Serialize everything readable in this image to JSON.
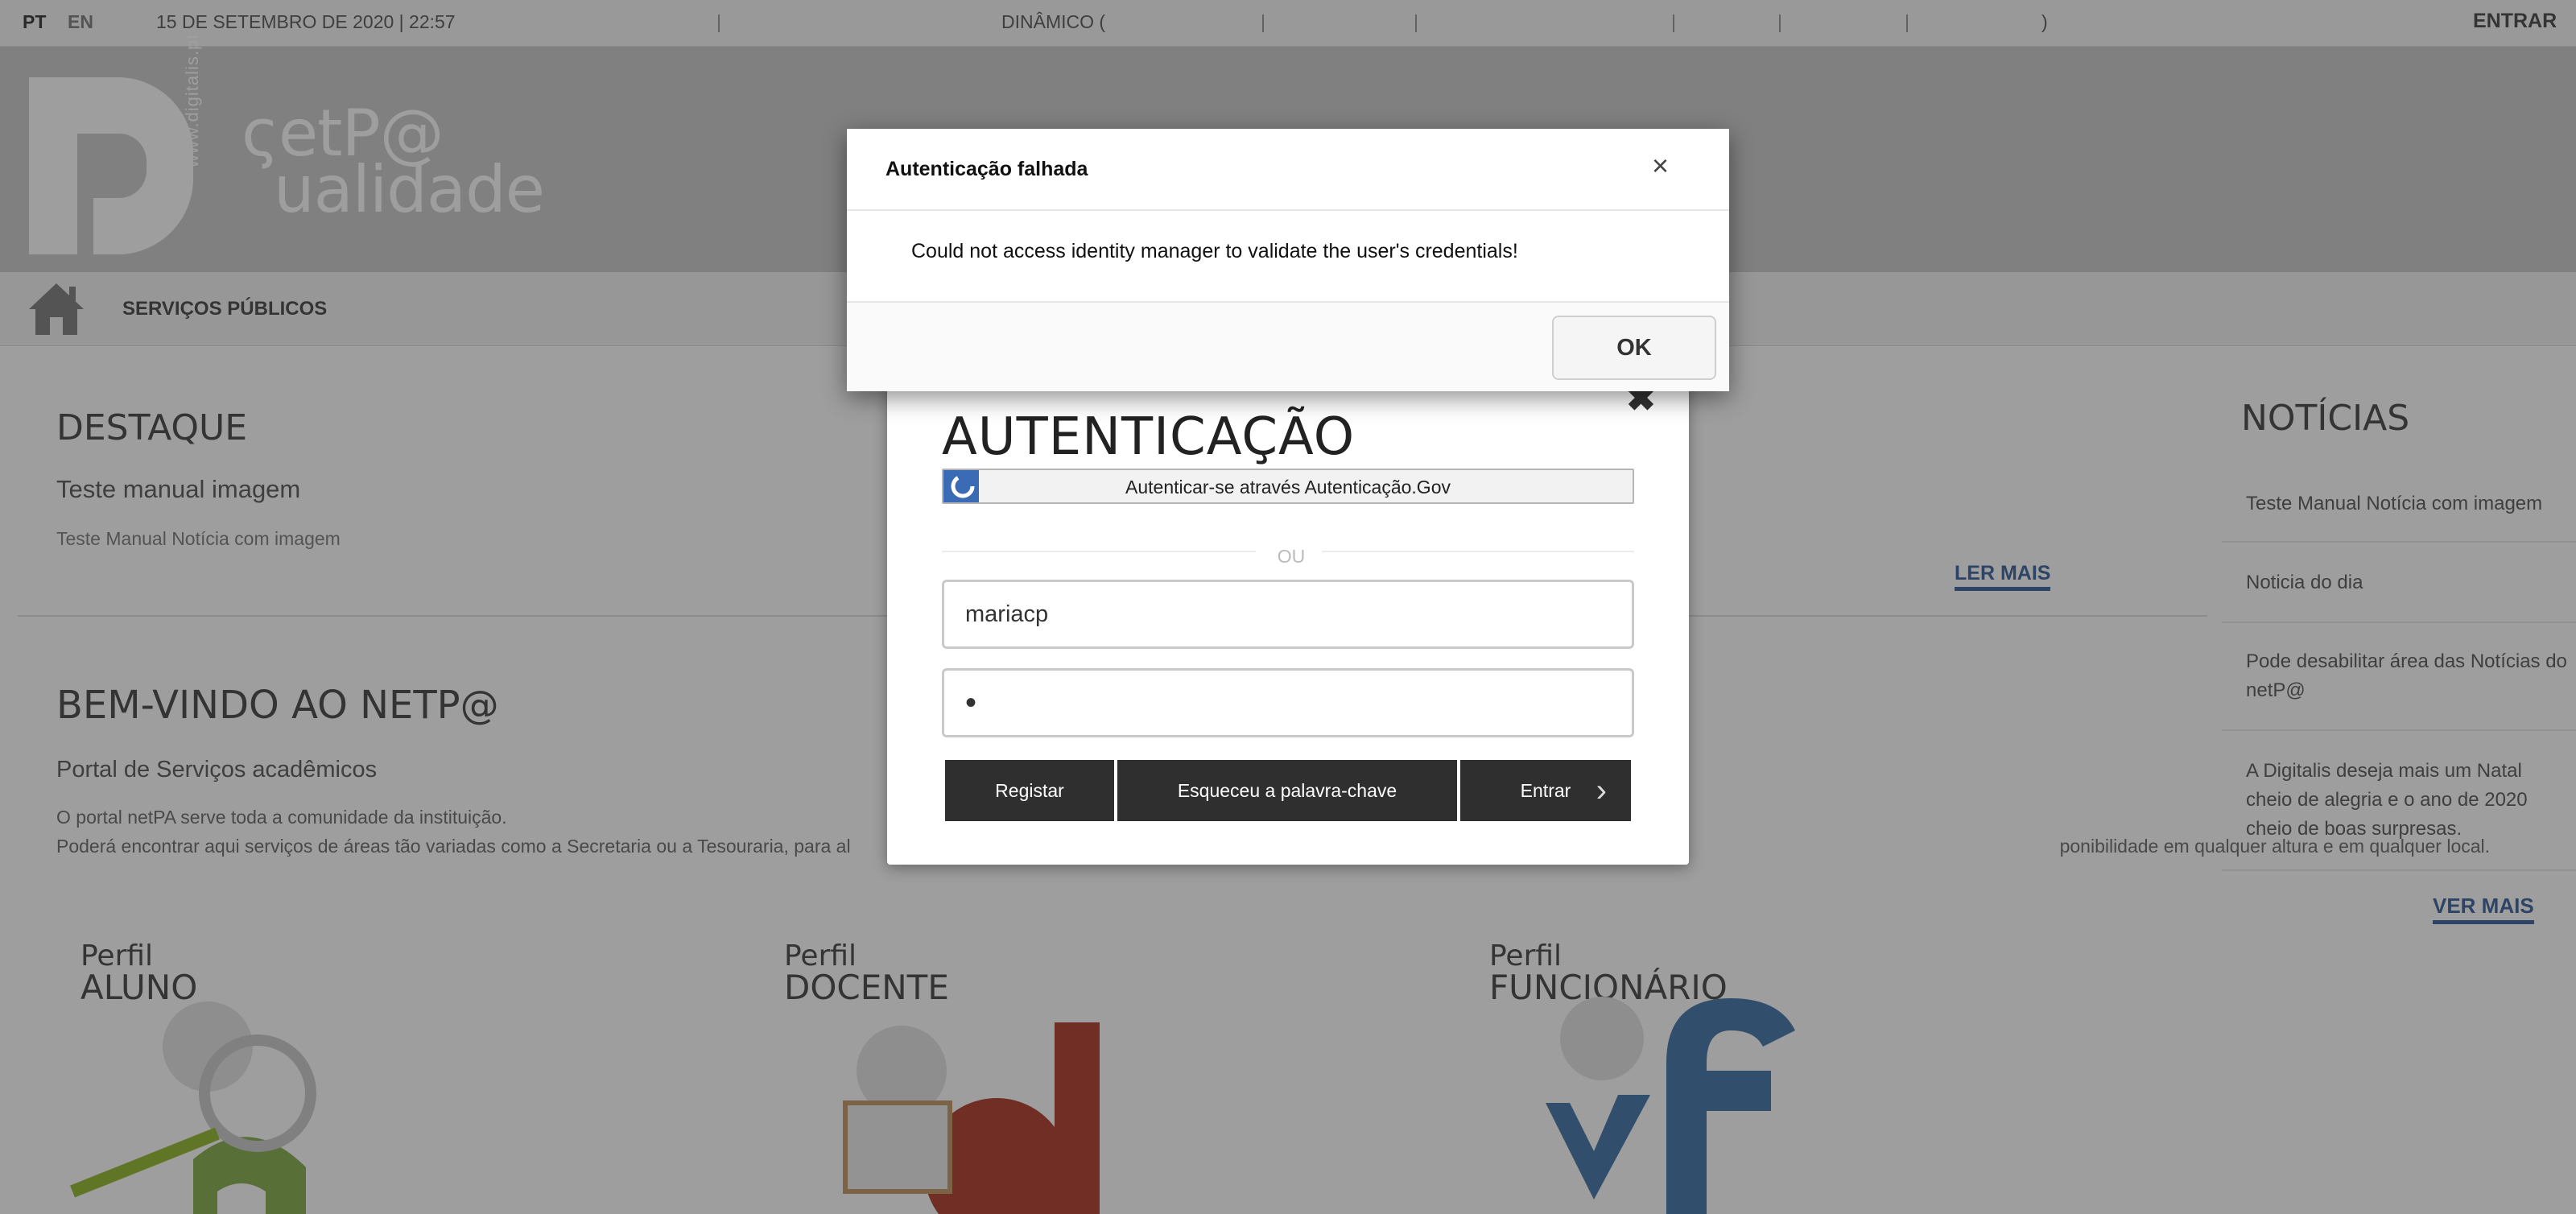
{
  "topbar": {
    "lang_pt": "PT",
    "lang_en": "EN",
    "datetime": "15 DE SETEMBRO DE 2020 | 22:57",
    "separator": "|",
    "dinamico": "DINÂMICO (",
    "close_paren": ")",
    "login": "ENTRAR"
  },
  "banner": {
    "site": "www.digitalis.pt",
    "logo_line1": "ςetP@",
    "logo_line2": "ualidade"
  },
  "nav": {
    "services": "SERVIÇOS PÚBLICOS"
  },
  "destaque": {
    "title": "DESTAQUE",
    "subtitle": "Teste manual imagem",
    "text": "Teste Manual Notícia com imagem",
    "read_more": "LER MAIS"
  },
  "welcome": {
    "title": "BEM-VINDO AO NETP@",
    "subtitle": "Portal de Serviços acadêmicos",
    "p1": "O portal netPA serve toda a comunidade da instituição.",
    "p2_start": "Poderá encontrar aqui serviços de áreas tão variadas como a Secretaria ou a Tesouraria, para al",
    "p2_end": "ponibilidade em qualquer altura e em qualquer local."
  },
  "profiles": [
    {
      "p1": "Perfil",
      "p2": "ALUNO"
    },
    {
      "p1": "Perfil",
      "p2": "DOCENTE"
    },
    {
      "p1": "Perfil",
      "p2": "FUNCIONÁRIO"
    }
  ],
  "news": {
    "title": "NOTÍCIAS",
    "items": [
      "Teste Manual Notícia com imagem",
      "Noticia do dia",
      "Pode desabilitar área das Notícias do netP@",
      "A Digitalis deseja mais um Natal cheio de alegria e o ano de 2020 cheio de boas surpresas."
    ],
    "see_more": "VER MAIS"
  },
  "login": {
    "close": "✖",
    "title": "AUTENTICAÇÃO",
    "gov_button": "Autenticar-se através Autenticação.Gov",
    "or": "OU",
    "username": "mariacp",
    "password_mask": "•",
    "register": "Registar",
    "forgot": "Esqueceu a palavra-chave",
    "enter": "Entrar"
  },
  "alert": {
    "title": "Autenticação falhada",
    "close": "×",
    "message": "Could not access identity manager to validate the user's credentials!",
    "ok": "OK"
  },
  "colors": {
    "accent_link": "#4a6fa5",
    "dark_button": "#2f2f2f",
    "gov_blue": "#3c6bb5",
    "overlay": "rgba(0,0,0,0.38)"
  }
}
